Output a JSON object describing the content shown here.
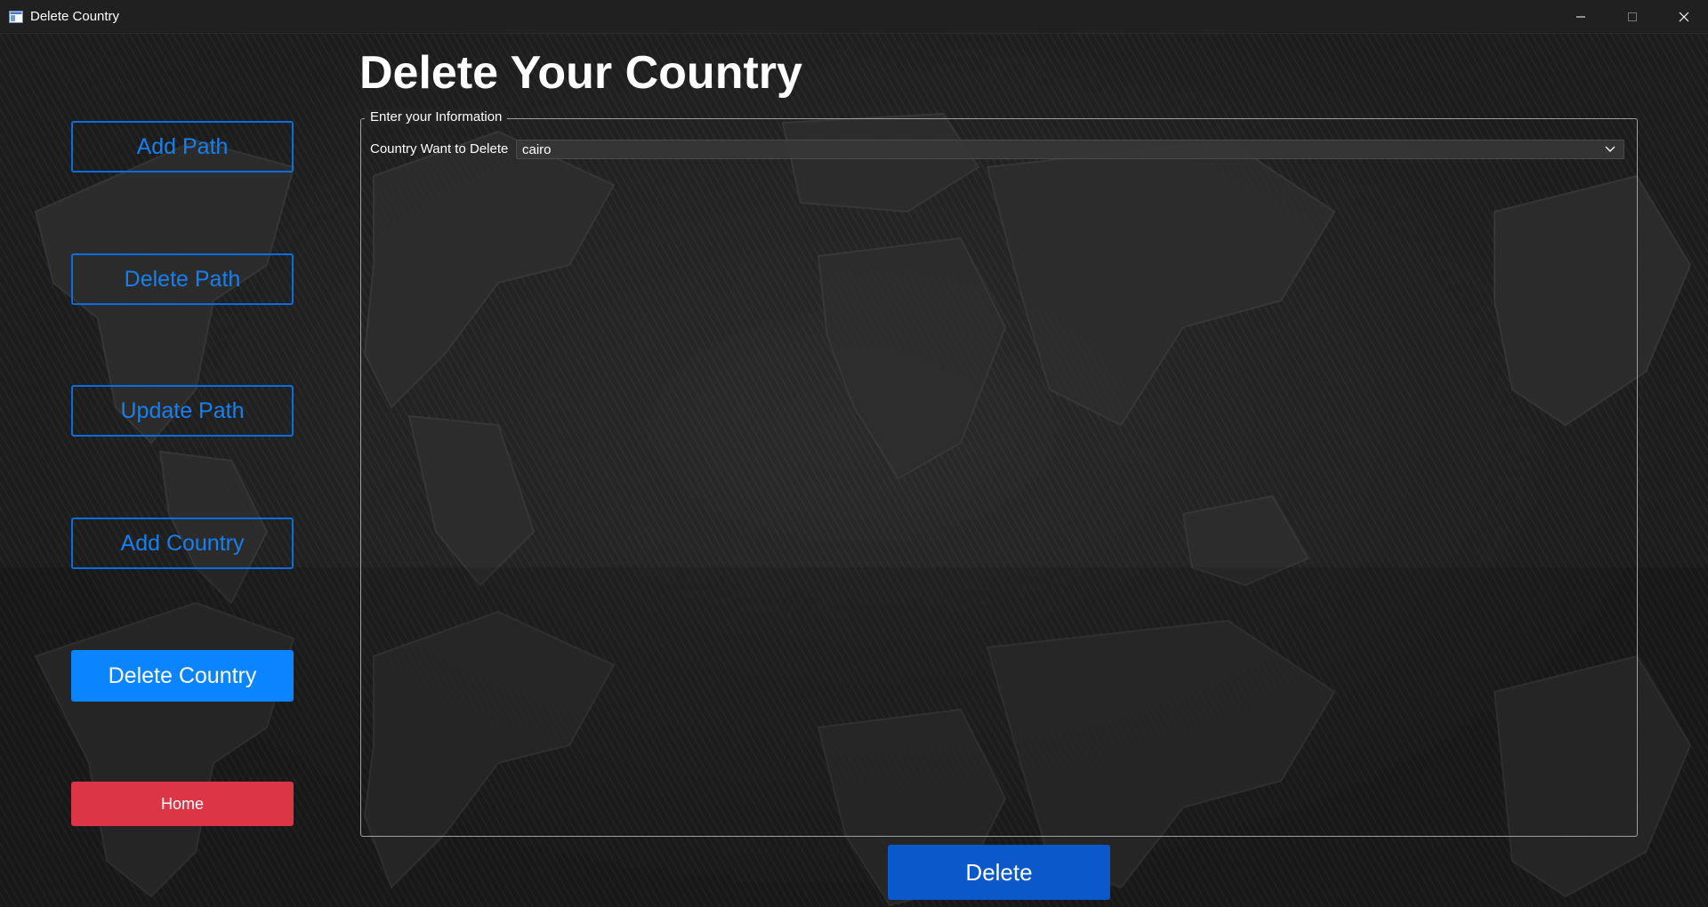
{
  "window": {
    "title": "Delete Country",
    "icon": "app-window-icon",
    "controls": [
      "minimize-icon",
      "maximize-icon",
      "close-icon"
    ]
  },
  "sidebar": {
    "items": [
      {
        "label": "Add Path"
      },
      {
        "label": "Delete Path"
      },
      {
        "label": "Update Path"
      },
      {
        "label": "Add Country"
      },
      {
        "label": "Delete Country",
        "active": true
      },
      {
        "label": "Home"
      }
    ]
  },
  "main": {
    "title": "Delete Your Country",
    "group": {
      "legend": "Enter your Information",
      "field_label": "Country Want to Delete",
      "combo_value": "cairo"
    },
    "delete_label": "Delete"
  },
  "colors": {
    "accent": "#0a84ff",
    "outline": "#0a6ee0",
    "danger": "#dc3545",
    "primary_dark": "#0a58ca",
    "background": "#1c1c1c"
  }
}
